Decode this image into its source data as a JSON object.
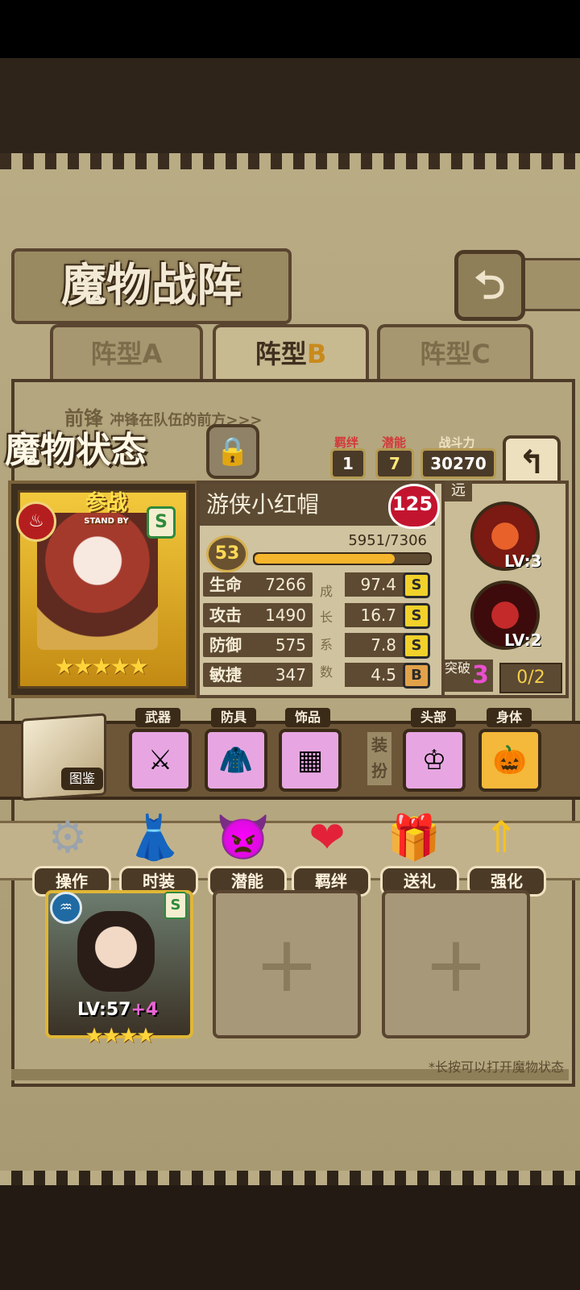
{
  "title": "魔物战阵",
  "tabs": [
    {
      "label": "阵型A"
    },
    {
      "label": "阵型",
      "suffix": "B"
    },
    {
      "label": "阵型C"
    }
  ],
  "vanguard": {
    "label": "前锋",
    "desc": "冲锋在队伍的前方>>>"
  },
  "status": {
    "title": "魔物状态",
    "bond_label": "羁绊",
    "bond_value": "1",
    "potential_label": "潜能",
    "potential_value": "7",
    "power_label": "战斗力",
    "power_value": "30270"
  },
  "card": {
    "standby": "参战",
    "standby_sub": "STAND BY",
    "grade": "S",
    "stars": "★★★★★"
  },
  "monster": {
    "name": "游侠小红帽",
    "bond_level": "125",
    "level": "53",
    "exp": "5951/7306",
    "exp_fraction": 0.8145,
    "stats": [
      {
        "label": "生命",
        "value": "7266",
        "growth": "97.4",
        "grade": "S"
      },
      {
        "label": "攻击",
        "value": "1490",
        "growth": "16.7",
        "grade": "S"
      },
      {
        "label": "防御",
        "value": "575",
        "growth": "7.8",
        "grade": "S"
      },
      {
        "label": "敏捷",
        "value": "347",
        "growth": "4.5",
        "grade": "B"
      }
    ],
    "growth_vertical": [
      "成",
      "长",
      "系",
      "数"
    ]
  },
  "skills": {
    "range": "远",
    "skill1_level": "LV:3",
    "skill2_level": "LV:2",
    "break_label": "突破",
    "break_value": "3",
    "break_progress": "0/2"
  },
  "equipment": {
    "book_label": "图鉴",
    "weapon_label": "武器",
    "armor_label": "防具",
    "accessory_label": "饰品",
    "dress_label": "装扮",
    "head_label": "头部",
    "body_label": "身体"
  },
  "menu": [
    {
      "label": "操作",
      "icon": "gear-icon"
    },
    {
      "label": "时装",
      "icon": "outfit-icon"
    },
    {
      "label": "潜能",
      "icon": "demon-icon"
    },
    {
      "label": "羁绊",
      "icon": "hearts-icon"
    },
    {
      "label": "送礼",
      "icon": "gift-icon"
    },
    {
      "label": "强化",
      "icon": "arrows-up-icon"
    }
  ],
  "team": {
    "hero2_level": "LV:57",
    "hero2_plus": "+4",
    "hero2_grade": "S",
    "hero2_stars": "★★★★",
    "hint": "*长按可以打开魔物状态"
  }
}
